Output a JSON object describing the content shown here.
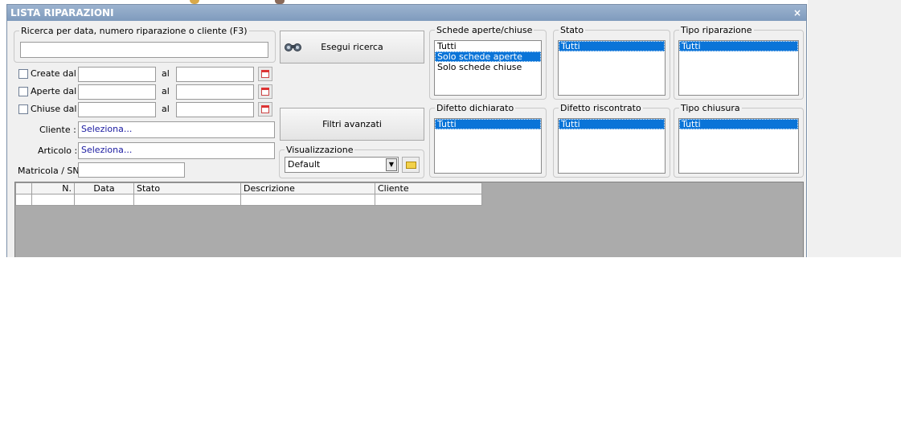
{
  "window": {
    "title": "LISTA RIPARAZIONI",
    "close_label": "×"
  },
  "search": {
    "legend": "Ricerca per data, numero riparazione o cliente (F3)",
    "value": "",
    "button_label": "Esegui ricerca"
  },
  "date_filters": [
    {
      "label": "Create dal",
      "from": "",
      "to_label": "al",
      "to": ""
    },
    {
      "label": "Aperte dal",
      "from": "",
      "to_label": "al",
      "to": ""
    },
    {
      "label": "Chiuse dal",
      "from": "",
      "to_label": "al",
      "to": ""
    }
  ],
  "fields": {
    "cliente_label": "Cliente :",
    "cliente_value": "Seleziona...",
    "articolo_label": "Articolo :",
    "articolo_value": "Seleziona...",
    "matricola_label": "Matricola / SN:",
    "matricola_value": ""
  },
  "advanced_button": "Filtri avanzati",
  "visualizzazione": {
    "legend": "Visualizzazione",
    "selected": "Default"
  },
  "filter_lists": {
    "schede": {
      "legend": "Schede aperte/chiuse",
      "items": [
        "Tutti",
        "Solo schede aperte",
        "Solo schede chiuse"
      ],
      "selected_index": 1
    },
    "stato": {
      "legend": "Stato",
      "items": [
        "Tutti"
      ],
      "selected_index": 0
    },
    "tipo_riparazione": {
      "legend": "Tipo riparazione",
      "items": [
        "Tutti"
      ],
      "selected_index": 0
    },
    "difetto_dichiarato": {
      "legend": "Difetto dichiarato",
      "items": [
        "Tutti"
      ],
      "selected_index": 0
    },
    "difetto_riscontrato": {
      "legend": "Difetto riscontrato",
      "items": [
        "Tutti"
      ],
      "selected_index": 0
    },
    "tipo_chiusura": {
      "legend": "Tipo chiusura",
      "items": [
        "Tutti"
      ],
      "selected_index": 0
    }
  },
  "grid": {
    "columns": [
      "",
      "N.",
      "Data",
      "Stato",
      "Descrizione",
      "Cliente"
    ],
    "rows": [
      [
        "",
        "",
        "",
        "",
        "",
        ""
      ]
    ]
  },
  "colors": {
    "title_bar": "#8aa5c6",
    "selection": "#0a74d8",
    "grid_bg": "#ababab"
  },
  "icons": {
    "search_button": "binoculars-icon",
    "calendar": "calendar-icon",
    "folder": "folder-icon"
  }
}
